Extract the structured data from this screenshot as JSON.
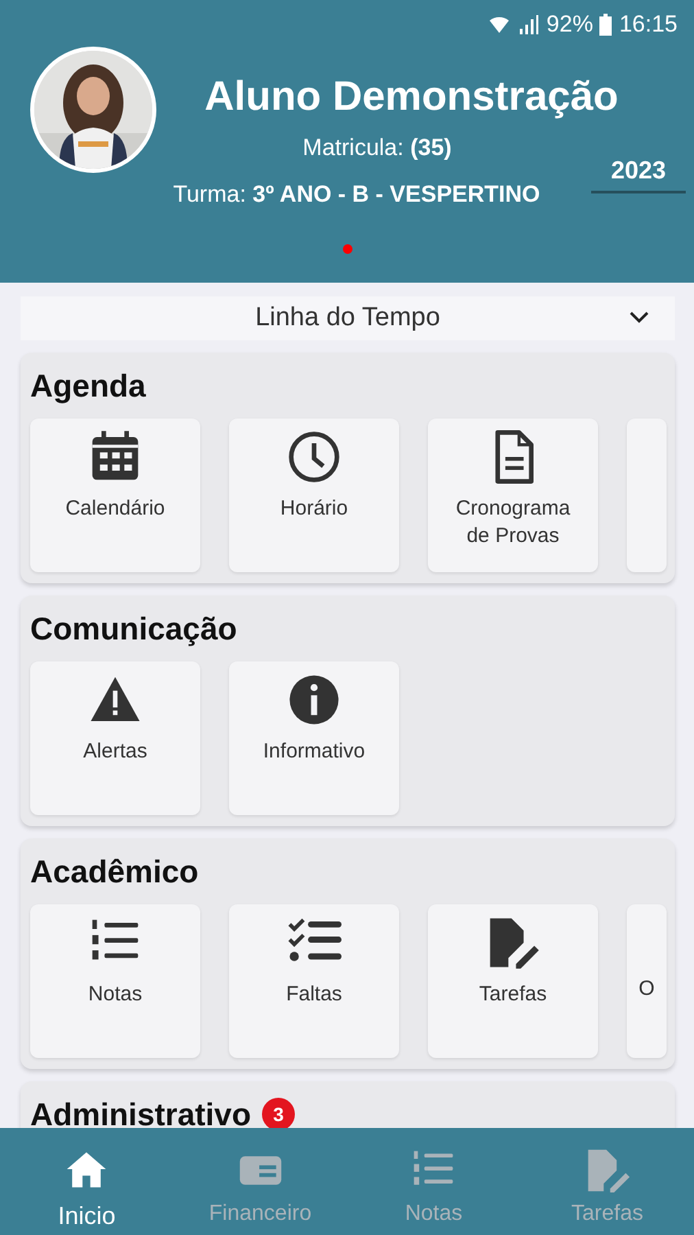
{
  "status_bar": {
    "battery": "92%",
    "time": "16:15"
  },
  "profile": {
    "name": "Aluno Demonstração",
    "enrollment": "Matricula: **(35)**",
    "class": "Turma: **3º ANO - B - VESPERTINO**",
    "year": "2023"
  },
  "pager": {
    "dots": [
      {
        "selected": true
      }
    ]
  },
  "view_selector": {
    "value": "Linha do Tempo"
  },
  "sections": [
    {
      "title": "Agenda",
      "tiles": [
        {
          "kind": "calendar",
          "label": "Calendário"
        },
        {
          "kind": "clock",
          "label": "Horário"
        },
        {
          "kind": "document",
          "label": "Cronograma de Provas"
        },
        {
          "kind": "partial"
        }
      ]
    },
    {
      "title": "Comunicação",
      "tiles": [
        {
          "kind": "alert",
          "label": "Alertas"
        },
        {
          "kind": "info",
          "label": "Informativo"
        }
      ]
    },
    {
      "title": "Acadêmico",
      "tiles": [
        {
          "kind": "numbered",
          "label": "Notas"
        },
        {
          "kind": "checklist",
          "label": "Faltas"
        },
        {
          "kind": "edit",
          "label": "Tarefas"
        },
        {
          "kind": "partial",
          "label": "O"
        }
      ]
    },
    {
      "title": "Administrativo",
      "badge": "3"
    }
  ],
  "bottom_nav": [
    {
      "kind": "home",
      "label": "Inicio",
      "selected": true
    },
    {
      "kind": "money",
      "label": "Financeiro",
      "selected": false
    },
    {
      "kind": "numbered",
      "label": "Notas",
      "selected": false
    },
    {
      "kind": "edit",
      "label": "Tarefas",
      "selected": false
    }
  ]
}
